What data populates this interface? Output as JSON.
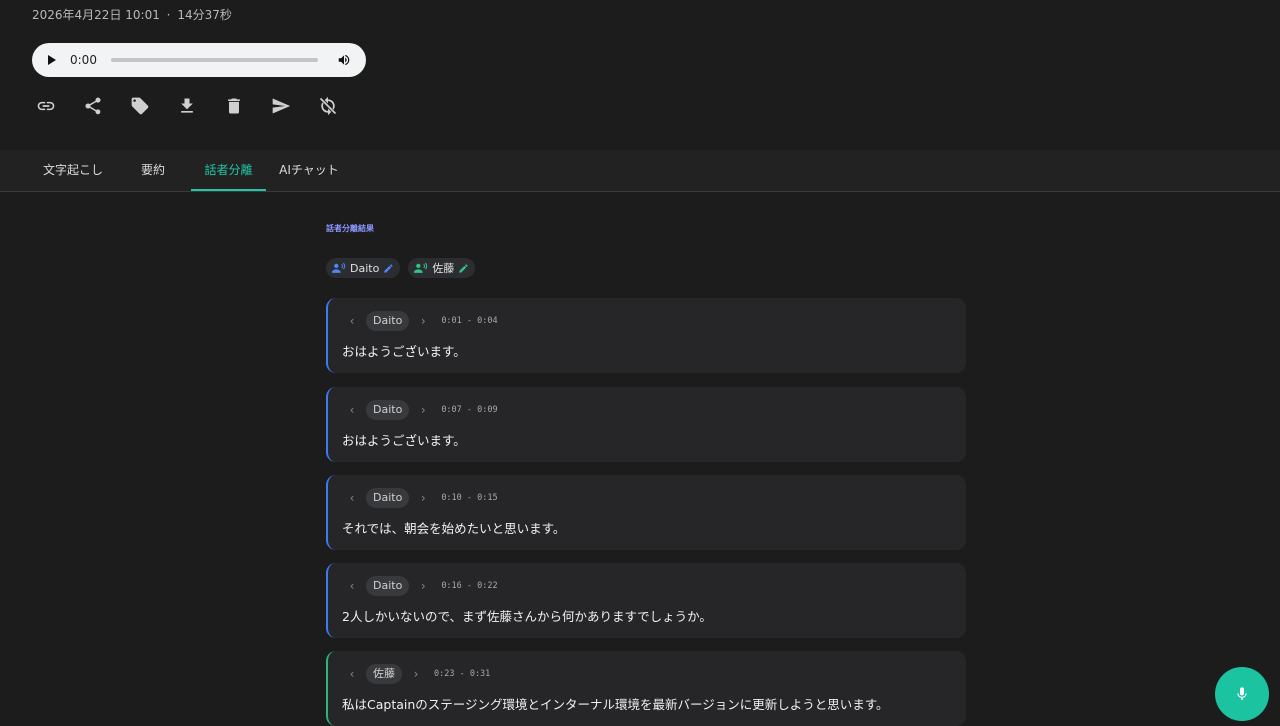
{
  "recording": {
    "datetime": "2026年4月22日 10:01",
    "separator": "·",
    "duration": "14分37秒"
  },
  "audio": {
    "current_time": "0:00",
    "progress": 0
  },
  "toolbar": {
    "icons": [
      "link-icon",
      "share-icon",
      "tag-icon",
      "download-icon",
      "delete-icon",
      "send-icon",
      "sync-icon"
    ]
  },
  "tabs": [
    {
      "label": "文字起こし",
      "active": false
    },
    {
      "label": "要約",
      "active": false
    },
    {
      "label": "話者分離",
      "active": true
    },
    {
      "label": "AIチャット",
      "active": false
    }
  ],
  "diarization": {
    "title": "話者分離結果",
    "speakers": [
      {
        "name": "Daito",
        "color": "#4f86f7"
      },
      {
        "name": "佐藤",
        "color": "#2fc48a"
      }
    ],
    "segments": [
      {
        "speaker": "Daito",
        "time": "0:01 - 0:04",
        "text": "おはようございます。",
        "color": "blue"
      },
      {
        "speaker": "Daito",
        "time": "0:07 - 0:09",
        "text": "おはようございます。",
        "color": "blue"
      },
      {
        "speaker": "Daito",
        "time": "0:10 - 0:15",
        "text": "それでは、朝会を始めたいと思います。",
        "color": "blue"
      },
      {
        "speaker": "Daito",
        "time": "0:16 - 0:22",
        "text": "2人しかいないので、まず佐藤さんから何かありますでしょうか。",
        "color": "blue"
      },
      {
        "speaker": "佐藤",
        "time": "0:23 - 0:31",
        "text": "私はCaptainのステージング環境とインターナル環境を最新バージョンに更新しようと思います。",
        "color": "green"
      }
    ]
  },
  "colors": {
    "accent": "#1fc7a3",
    "background": "#1c1c1d",
    "card": "#262628"
  },
  "fab": {
    "icon": "microphone-icon"
  }
}
